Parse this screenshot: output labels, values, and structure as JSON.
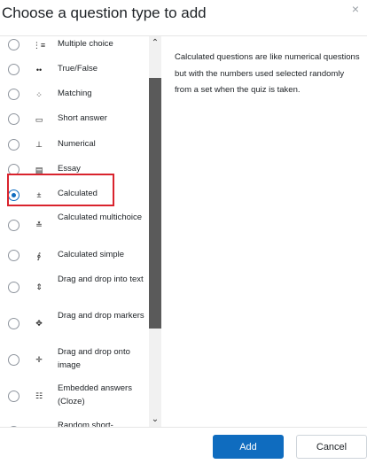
{
  "dialog": {
    "title": "Choose a question type to add",
    "close_glyph": "×"
  },
  "options": [
    {
      "label": "Multiple choice",
      "icon": "multiple-choice-icon",
      "glyph": "⋮≡",
      "selected": false
    },
    {
      "label": "True/False",
      "icon": "true-false-icon",
      "glyph": "••",
      "selected": false
    },
    {
      "label": "Matching",
      "icon": "matching-icon",
      "glyph": "⁘",
      "selected": false
    },
    {
      "label": "Short answer",
      "icon": "short-answer-icon",
      "glyph": "▭",
      "selected": false
    },
    {
      "label": "Numerical",
      "icon": "numerical-icon",
      "glyph": "⊥",
      "selected": false
    },
    {
      "label": "Essay",
      "icon": "essay-icon",
      "glyph": "▤",
      "selected": false
    },
    {
      "label": "Calculated",
      "icon": "calculated-icon",
      "glyph": "±",
      "selected": true
    },
    {
      "label": "Calculated multichoice",
      "icon": "calculated-multichoice-icon",
      "glyph": "≛",
      "selected": false
    },
    {
      "label": "Calculated simple",
      "icon": "calculated-simple-icon",
      "glyph": "∮",
      "selected": false
    },
    {
      "label": "Drag and drop into text",
      "icon": "drag-drop-text-icon",
      "glyph": "⇕",
      "selected": false
    },
    {
      "label": "Drag and drop markers",
      "icon": "drag-drop-markers-icon",
      "glyph": "✥",
      "selected": false
    },
    {
      "label": "Drag and drop onto image",
      "icon": "drag-drop-image-icon",
      "glyph": "✛",
      "selected": false
    },
    {
      "label": "Embedded answers (Cloze)",
      "icon": "embedded-answers-icon",
      "glyph": "☷",
      "selected": false
    },
    {
      "label": "Random short-",
      "icon": "random-short-icon",
      "glyph": "",
      "selected": false
    }
  ],
  "description": "Calculated questions are like numerical questions but with the numbers used selected randomly from a set when the quiz is taken.",
  "footer": {
    "add_label": "Add",
    "cancel_label": "Cancel"
  },
  "colors": {
    "accent": "#0f6cbf",
    "highlight_border": "#d9232d"
  }
}
